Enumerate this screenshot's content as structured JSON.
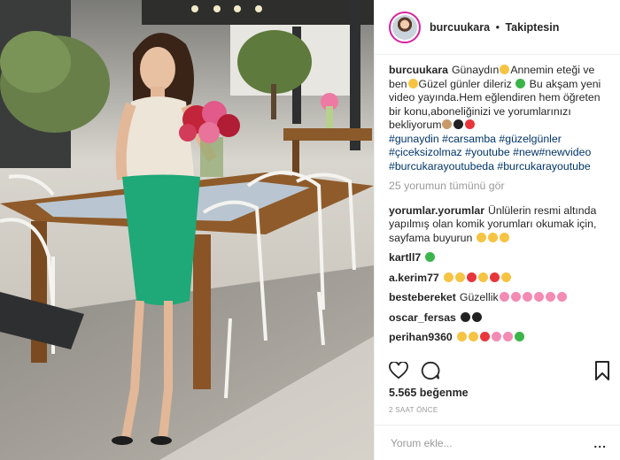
{
  "post": {
    "username": "burcuukara",
    "separator": "•",
    "follow_status": "Takiptesin",
    "caption_text": "Günaydın",
    "caption_line2": "Annemin eteği ve ben",
    "caption_line3": "Güzel günler dileriz",
    "caption_line4": "Bu akşam yeni video yayında.Hem eğlendiren hem öğreten bir konu,aboneliğinizi ve yorumlarınızı bekliyorum",
    "hashtags_line1": "#gunaydin #carsamba #güzelgünler",
    "hashtags_line2": "#çiceksizolmaz #youtube #new#newvideo",
    "hashtags_line3": "#burcukarayoutubeda #burcukarayoutube",
    "view_all_comments": "25 yorumun tümünü gör",
    "likes": "5.565 beğenme",
    "time_ago": "2 SAAT ÖNCE",
    "add_comment_placeholder": "Yorum ekle...",
    "more": "..."
  },
  "comments": [
    {
      "user": "yorumlar.yorumlar",
      "text": "Ünlülerin resmi altında yapılmış olan komik yorumları okumak için, sayfama buyurun"
    },
    {
      "user": "kartll7",
      "text": ""
    },
    {
      "user": "a.kerim77",
      "text": ""
    },
    {
      "user": "bestebereket",
      "text": "Güzellik"
    },
    {
      "user": "oscar_fersas",
      "text": ""
    },
    {
      "user": "perihan9360",
      "text": ""
    }
  ],
  "icons": [
    "heart-icon",
    "comment-icon",
    "bookmark-icon",
    "more-options-icon"
  ],
  "colors": {
    "hashtag": "#003569",
    "muted": "#999999",
    "text": "#262626",
    "skirt": "#1fa878"
  }
}
